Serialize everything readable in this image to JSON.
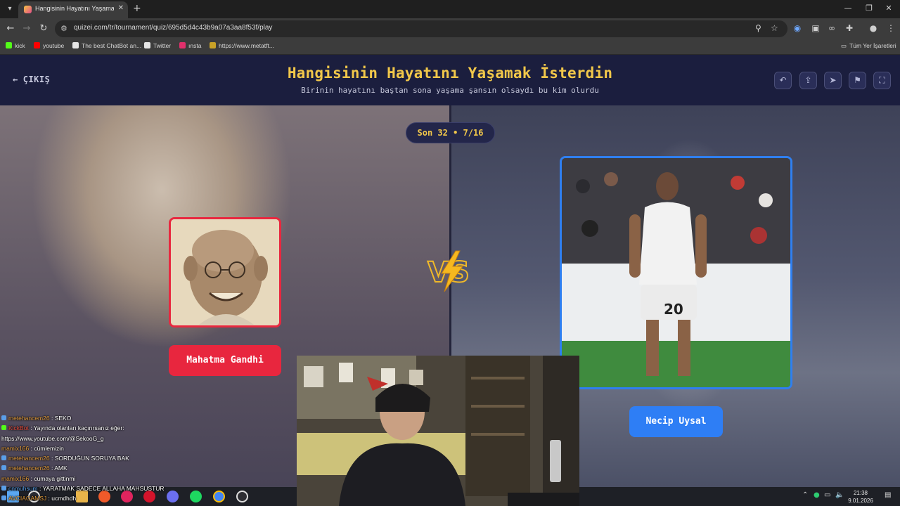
{
  "browser": {
    "tab_title": "Hangisinin Hayatını Yaşamak İs",
    "url": "quizei.com/tr/tournament/quiz/695d5d4c43b9a07a3aa8f53f/play",
    "bookmarks": [
      {
        "label": "kick",
        "color": "#53fc18"
      },
      {
        "label": "youtube",
        "color": "#ff0000"
      },
      {
        "label": "The best ChatBot an...",
        "color": "#e6e6e6"
      },
      {
        "label": "Twitter",
        "color": "#e6e6e6"
      },
      {
        "label": "ınsta",
        "color": "#e1306c"
      },
      {
        "label": "https://www.metatft...",
        "color": "#c9a227"
      }
    ],
    "all_bookmarks_label": "Tüm Yer İşaretleri"
  },
  "header": {
    "exit_label": "ÇIKIŞ",
    "title": "Hangisinin Hayatını Yaşamak İsterdin",
    "subtitle": "Birinin hayatını baştan sona yaşama şansın olsaydı bu kim olurdu",
    "actions": [
      "undo-icon",
      "share-icon",
      "send-icon",
      "flag-icon",
      "fullscreen-icon"
    ]
  },
  "round": {
    "label": "Son 32 • 7/16"
  },
  "contestants": {
    "left": {
      "name": "Mahatma Gandhi",
      "accent": "#e8263e"
    },
    "right": {
      "name": "Necip Uysal",
      "accent": "#2e7ef5"
    }
  },
  "vs_label": "VS",
  "chat": [
    {
      "user": "metehancem26",
      "message": "SEKO",
      "user_color": "orange"
    },
    {
      "user": "KickBot",
      "message": "Yayında olanları kaçırırsanız eğer:",
      "user_color": "red"
    },
    {
      "user": "",
      "message": "https://www.youtube.com/@SekooG_g",
      "user_color": ""
    },
    {
      "user": "mamix166",
      "message": "cümlemizin",
      "user_color": "orange"
    },
    {
      "user": "metehancem26",
      "message": "SORDUĞUN SORUYA BAK",
      "user_color": "orange"
    },
    {
      "user": "metehancem26",
      "message": "AMK",
      "user_color": "orange"
    },
    {
      "user": "mamix166",
      "message": "cumaya gittinmi",
      "user_color": "orange"
    },
    {
      "user": "cnmuhsum",
      "message": "YARATMAK SADECE ALLAHA MAHSUSTUR",
      "user_color": "blue"
    },
    {
      "user": "AVCIAGAMSJ",
      "message": "ucmdhdh",
      "user_color": "orange"
    }
  ],
  "taskbar": {
    "time": "21:38",
    "date": "9.01.2026"
  }
}
